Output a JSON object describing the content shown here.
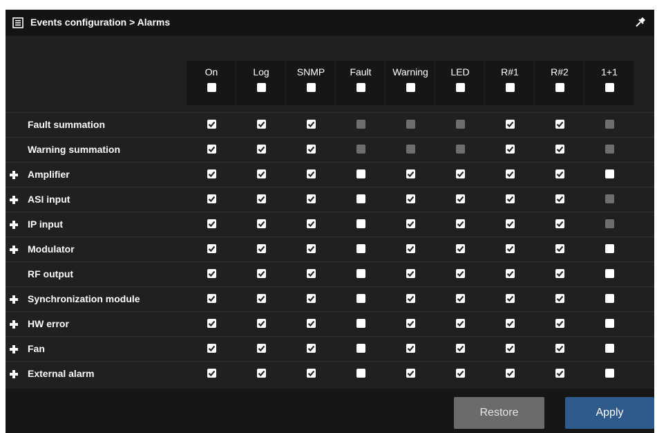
{
  "window": {
    "title": "Events configuration > Alarms",
    "icon": "list-icon",
    "pin_icon": "pin-icon"
  },
  "columns": [
    "On",
    "Log",
    "SNMP",
    "Fault",
    "Warning",
    "LED",
    "R#1",
    "R#2",
    "1+1"
  ],
  "rows": [
    {
      "label": "Fault summation",
      "expandable": false,
      "cells": [
        "checked",
        "checked",
        "checked",
        "disabled",
        "disabled",
        "disabled",
        "checked",
        "checked",
        "disabled"
      ]
    },
    {
      "label": "Warning summation",
      "expandable": false,
      "cells": [
        "checked",
        "checked",
        "checked",
        "disabled",
        "disabled",
        "disabled",
        "checked",
        "checked",
        "disabled"
      ]
    },
    {
      "label": "Amplifier",
      "expandable": true,
      "cells": [
        "checked",
        "checked",
        "checked",
        "unchecked",
        "checked",
        "checked",
        "checked",
        "checked",
        "unchecked"
      ]
    },
    {
      "label": "ASI input",
      "expandable": true,
      "cells": [
        "checked",
        "checked",
        "checked",
        "unchecked",
        "checked",
        "checked",
        "checked",
        "checked",
        "disabled"
      ]
    },
    {
      "label": "IP input",
      "expandable": true,
      "cells": [
        "checked",
        "checked",
        "checked",
        "unchecked",
        "checked",
        "checked",
        "checked",
        "checked",
        "disabled"
      ]
    },
    {
      "label": "Modulator",
      "expandable": true,
      "cells": [
        "checked",
        "checked",
        "checked",
        "unchecked",
        "checked",
        "checked",
        "checked",
        "checked",
        "unchecked"
      ]
    },
    {
      "label": "RF output",
      "expandable": false,
      "cells": [
        "checked",
        "checked",
        "checked",
        "unchecked",
        "checked",
        "checked",
        "checked",
        "checked",
        "unchecked"
      ]
    },
    {
      "label": "Synchronization module",
      "expandable": true,
      "cells": [
        "checked",
        "checked",
        "checked",
        "unchecked",
        "checked",
        "checked",
        "checked",
        "checked",
        "unchecked"
      ]
    },
    {
      "label": "HW error",
      "expandable": true,
      "cells": [
        "checked",
        "checked",
        "checked",
        "unchecked",
        "checked",
        "checked",
        "checked",
        "checked",
        "unchecked"
      ]
    },
    {
      "label": "Fan",
      "expandable": true,
      "cells": [
        "checked",
        "checked",
        "checked",
        "unchecked",
        "checked",
        "checked",
        "checked",
        "checked",
        "unchecked"
      ]
    },
    {
      "label": "External alarm",
      "expandable": true,
      "cells": [
        "checked",
        "checked",
        "checked",
        "unchecked",
        "checked",
        "checked",
        "checked",
        "checked",
        "unchecked"
      ]
    }
  ],
  "buttons": {
    "restore_label": "Restore",
    "apply_label": "Apply"
  },
  "colors": {
    "panel_bg": "#202020",
    "titlebar_bg": "#141414",
    "apply_bg": "#2e5a8c",
    "restore_bg": "#6b6b6b",
    "disabled_box": "#6e6e6e"
  }
}
